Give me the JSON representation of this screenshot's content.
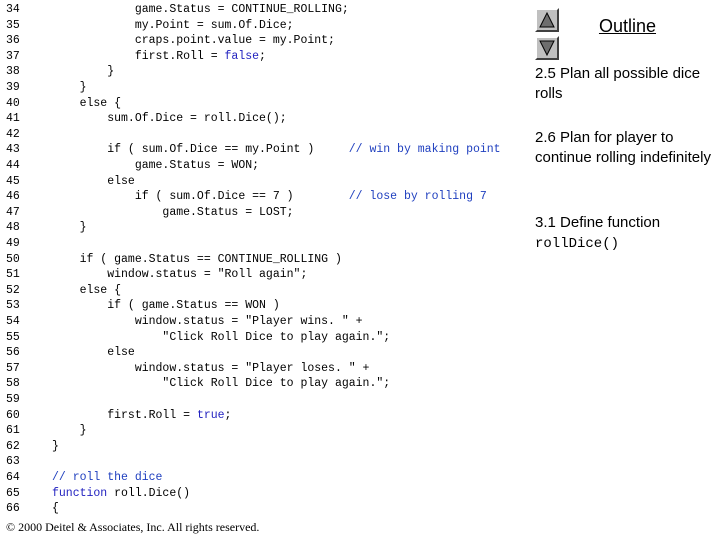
{
  "code": {
    "lines": [
      {
        "num": "34",
        "segs": [
          {
            "t": "            game.Status = CONTINUE_ROLLING;",
            "c": "tx"
          }
        ]
      },
      {
        "num": "35",
        "segs": [
          {
            "t": "            my.Point = sum.Of.Dice;",
            "c": "tx"
          }
        ]
      },
      {
        "num": "36",
        "segs": [
          {
            "t": "            craps.point.value = my.Point;",
            "c": "tx"
          }
        ]
      },
      {
        "num": "37",
        "segs": [
          {
            "t": "            first.Roll = ",
            "c": "tx"
          },
          {
            "t": "false",
            "c": "kw"
          },
          {
            "t": ";",
            "c": "tx"
          }
        ]
      },
      {
        "num": "38",
        "segs": [
          {
            "t": "        }",
            "c": "tx"
          }
        ]
      },
      {
        "num": "39",
        "segs": [
          {
            "t": "    }",
            "c": "tx"
          }
        ]
      },
      {
        "num": "40",
        "segs": [
          {
            "t": "    else {",
            "c": "tx"
          }
        ]
      },
      {
        "num": "41",
        "segs": [
          {
            "t": "        sum.Of.Dice = roll.Dice();",
            "c": "tx"
          }
        ]
      },
      {
        "num": "42",
        "segs": []
      },
      {
        "num": "43",
        "segs": [
          {
            "t": "        if ( sum.Of.Dice == my.Point )     ",
            "c": "tx"
          },
          {
            "t": "// win by making point",
            "c": "cm"
          }
        ]
      },
      {
        "num": "44",
        "segs": [
          {
            "t": "            game.Status = WON;",
            "c": "tx"
          }
        ]
      },
      {
        "num": "45",
        "segs": [
          {
            "t": "        else",
            "c": "tx"
          }
        ]
      },
      {
        "num": "46",
        "segs": [
          {
            "t": "            if ( sum.Of.Dice == 7 )        ",
            "c": "tx"
          },
          {
            "t": "// lose by rolling 7",
            "c": "cm"
          }
        ]
      },
      {
        "num": "47",
        "segs": [
          {
            "t": "                game.Status = LOST;",
            "c": "tx"
          }
        ]
      },
      {
        "num": "48",
        "segs": [
          {
            "t": "    }",
            "c": "tx"
          }
        ]
      },
      {
        "num": "49",
        "segs": []
      },
      {
        "num": "50",
        "segs": [
          {
            "t": "    if ( game.Status == CONTINUE_ROLLING )",
            "c": "tx"
          }
        ]
      },
      {
        "num": "51",
        "segs": [
          {
            "t": "        window.status = \"Roll again\";",
            "c": "tx"
          }
        ]
      },
      {
        "num": "52",
        "segs": [
          {
            "t": "    else {",
            "c": "tx"
          }
        ]
      },
      {
        "num": "53",
        "segs": [
          {
            "t": "        if ( game.Status == WON )",
            "c": "tx"
          }
        ]
      },
      {
        "num": "54",
        "segs": [
          {
            "t": "            window.status = \"Player wins. \" +",
            "c": "tx"
          }
        ]
      },
      {
        "num": "55",
        "segs": [
          {
            "t": "                \"Click Roll Dice to play again.\";",
            "c": "tx"
          }
        ]
      },
      {
        "num": "56",
        "segs": [
          {
            "t": "        else",
            "c": "tx"
          }
        ]
      },
      {
        "num": "57",
        "segs": [
          {
            "t": "            window.status = \"Player loses. \" +",
            "c": "tx"
          }
        ]
      },
      {
        "num": "58",
        "segs": [
          {
            "t": "                \"Click Roll Dice to play again.\";",
            "c": "tx"
          }
        ]
      },
      {
        "num": "59",
        "segs": []
      },
      {
        "num": "60",
        "segs": [
          {
            "t": "        first.Roll = ",
            "c": "tx"
          },
          {
            "t": "true",
            "c": "kw"
          },
          {
            "t": ";",
            "c": "tx"
          }
        ]
      },
      {
        "num": "61",
        "segs": [
          {
            "t": "    }",
            "c": "tx"
          }
        ]
      },
      {
        "num": "62",
        "segs": [
          {
            "t": "}",
            "c": "tx"
          }
        ]
      },
      {
        "num": "63",
        "segs": []
      },
      {
        "num": "64",
        "segs": [
          {
            "t": "// roll the dice",
            "c": "cm"
          }
        ]
      },
      {
        "num": "65",
        "segs": [
          {
            "t": "function",
            "c": "kw"
          },
          {
            "t": " roll.Dice()",
            "c": "tx"
          }
        ]
      },
      {
        "num": "66",
        "segs": [
          {
            "t": "{",
            "c": "tx"
          }
        ]
      }
    ]
  },
  "footer": "© 2000 Deitel & Associates, Inc.  All rights reserved.",
  "outline": {
    "title": "Outline",
    "items": [
      {
        "text": "2.5 Plan all possible dice rolls"
      },
      {
        "text": "2.6 Plan for player to continue rolling indefinitely"
      },
      {
        "text": "3.1 Define function",
        "code": "rollDice()"
      }
    ]
  },
  "nav": {
    "up_icon": "triangle-up-icon",
    "down_icon": "triangle-down-icon"
  },
  "colors": {
    "keyword": "#1f1fbf",
    "comment": "#1f3fbf",
    "button_face": "#c0c0c0"
  }
}
